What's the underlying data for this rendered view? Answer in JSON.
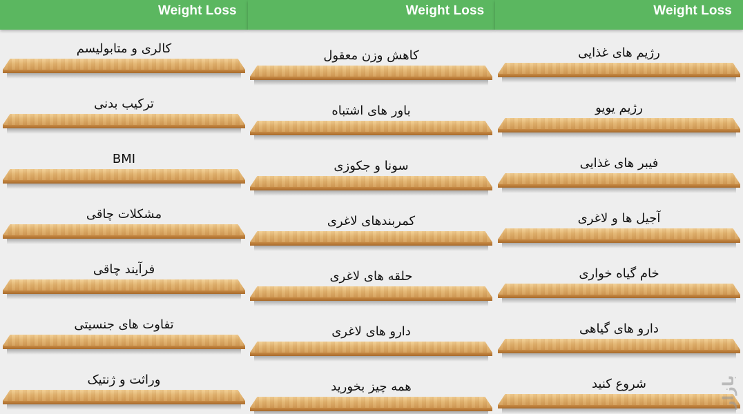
{
  "topbar": {
    "titles": [
      "Weight Loss",
      "Weight Loss",
      "Weight Loss"
    ]
  },
  "columns": {
    "right": [
      "رژیم های غذایی",
      "رژیم یویو",
      "فیبر های غذایی",
      "آجیل ها و لاغری",
      "خام گیاه خواری",
      "دارو های گیاهی",
      "شروع کنید"
    ],
    "middle": [
      "کاهش وزن معقول",
      "باور های اشتباه",
      "سونا و جکوزی",
      "کمربندهای لاغری",
      "حلقه های لاغری",
      "دارو های لاغری",
      "همه چیز بخورید"
    ],
    "left": [
      "کالری و متابولیسم",
      "ترکیب بدنی",
      "BMI",
      "مشکلات چاقی",
      "فرآیند چاقی",
      "تفاوت های جنسیتی",
      "وراثت و ژنتیک"
    ]
  },
  "watermark": "بازار",
  "colors": {
    "toolbar": "#5bb760",
    "background": "#eeeeee",
    "wood": "#e2b36f"
  }
}
